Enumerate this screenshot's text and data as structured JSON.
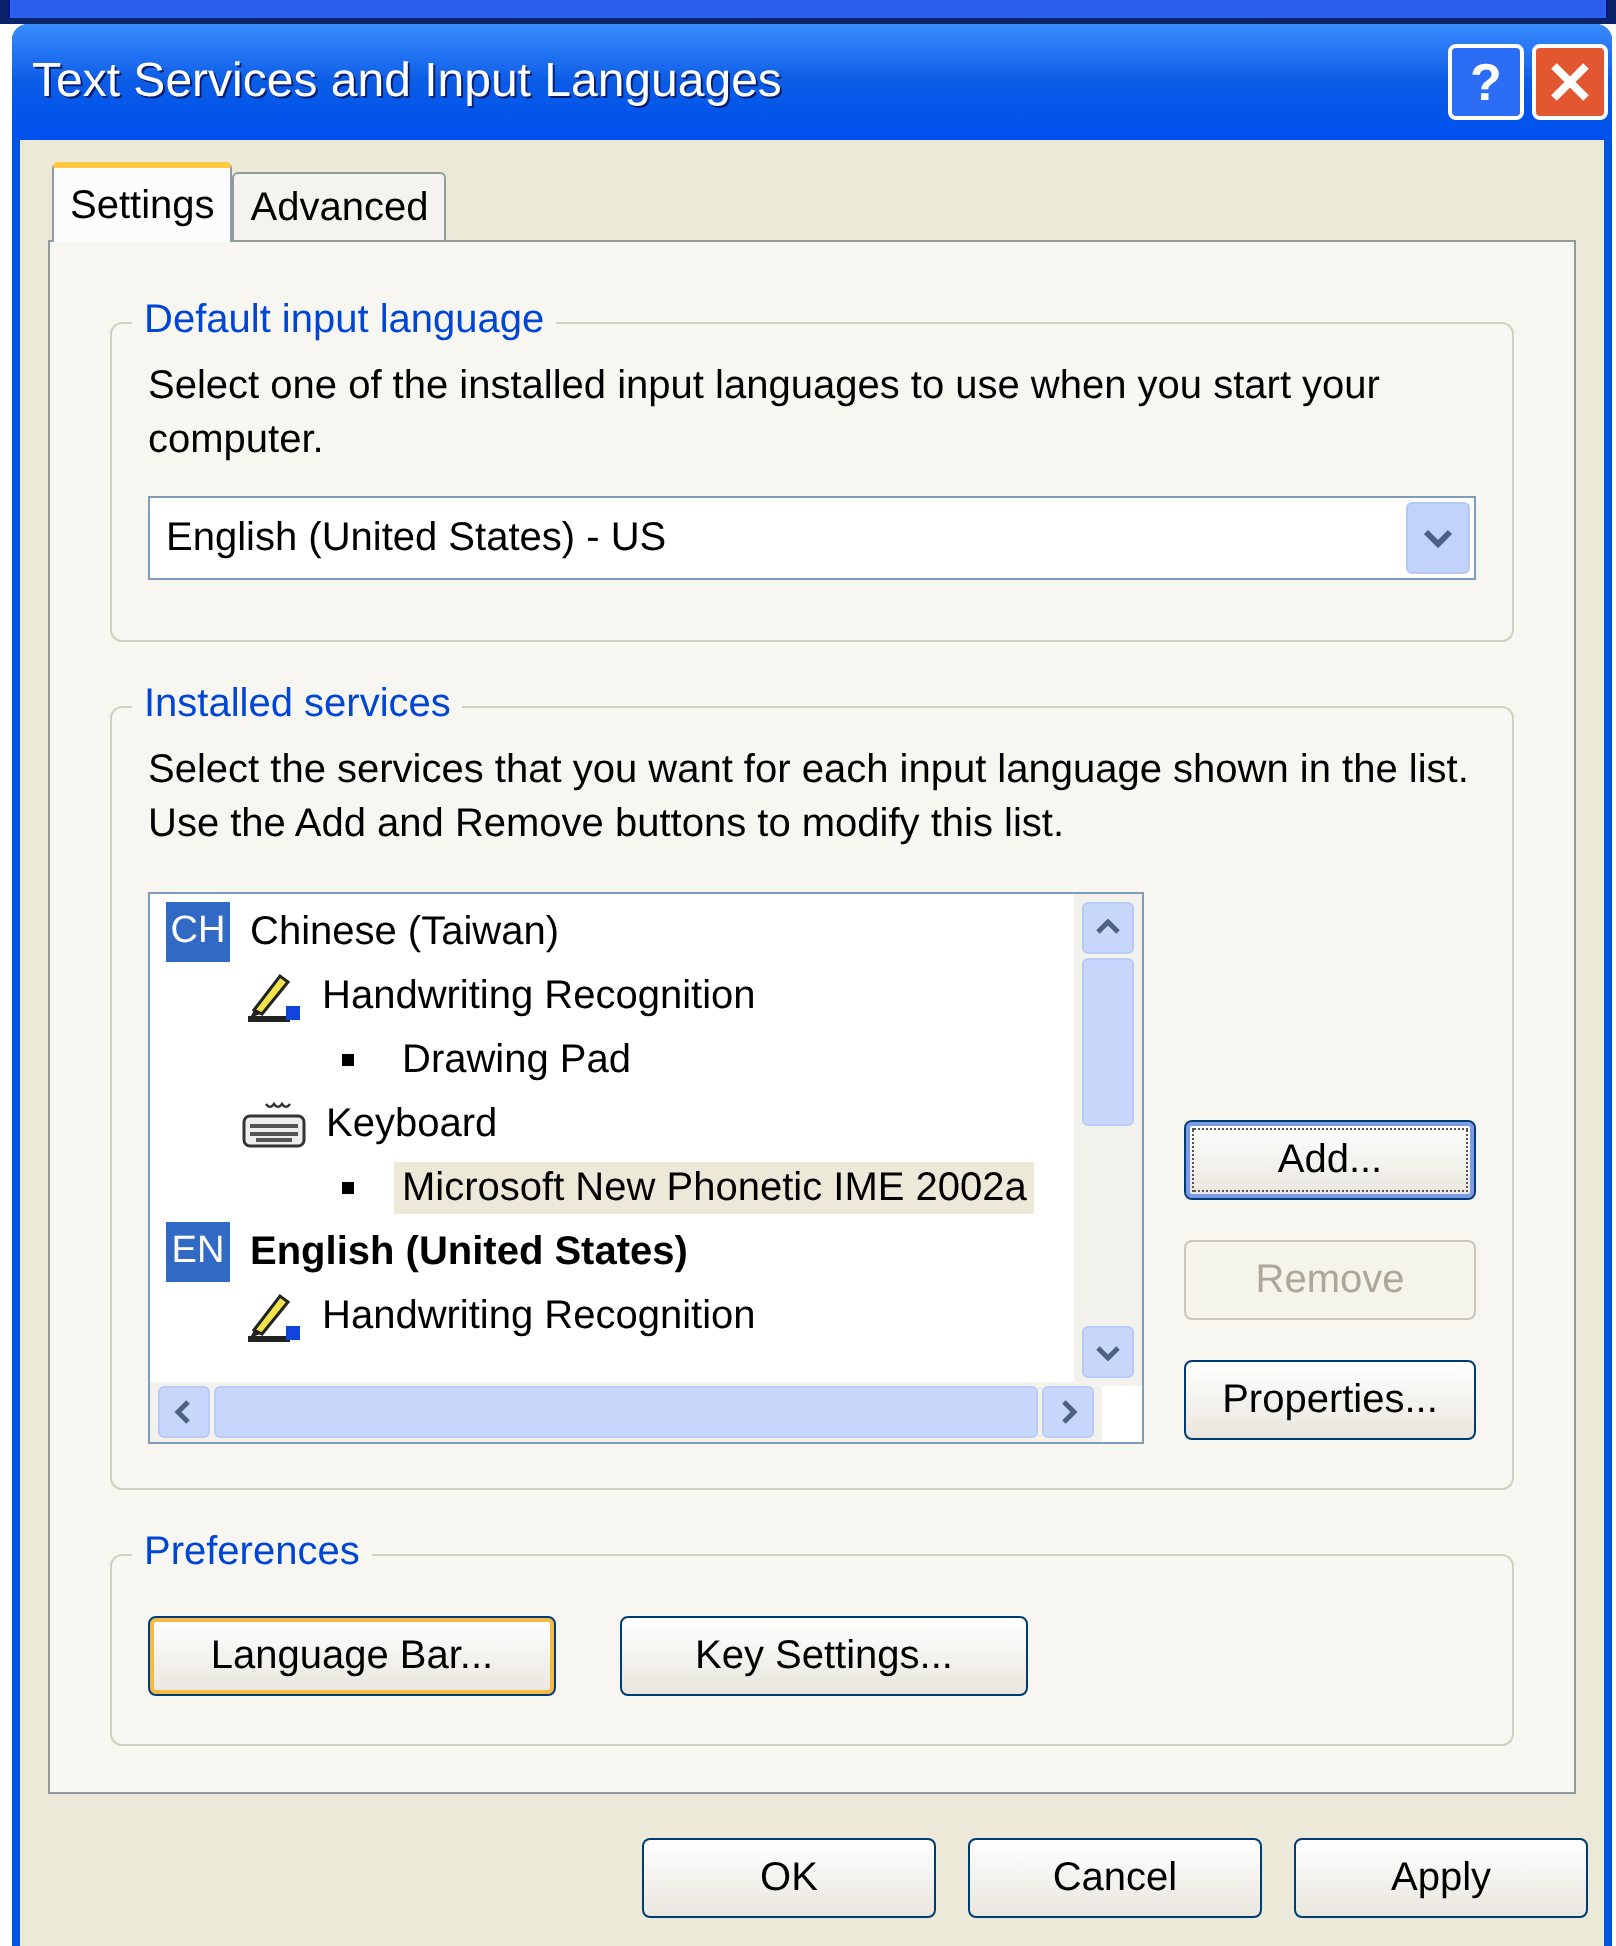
{
  "window": {
    "title": "Text Services and Input Languages",
    "title_buttons": [
      {
        "kind": "help",
        "label": "?"
      },
      {
        "kind": "close"
      }
    ]
  },
  "tabs": [
    {
      "label": "Settings",
      "selected": true
    },
    {
      "label": "Advanced",
      "selected": false
    }
  ],
  "default_input_language": {
    "title": "Default input language",
    "description": "Select one of the installed input languages to use when you start your computer.",
    "value": "English (United States) - US"
  },
  "installed_services": {
    "title": "Installed services",
    "description": "Select the services that you want for each input language shown in the list. Use the Add and Remove buttons to modify this list.",
    "tree": [
      {
        "code": "CH",
        "label": "Chinese (Taiwan)",
        "default": false,
        "children": [
          {
            "kind": "handwriting",
            "label": "Handwriting Recognition",
            "children": [
              {
                "label": "Drawing Pad",
                "selected": false
              }
            ]
          },
          {
            "kind": "keyboard",
            "label": "Keyboard",
            "children": [
              {
                "label": "Microsoft New Phonetic IME 2002a",
                "selected": true
              }
            ]
          }
        ]
      },
      {
        "code": "EN",
        "label": "English (United States)",
        "default": true,
        "children": [
          {
            "kind": "handwriting",
            "label": "Handwriting Recognition"
          }
        ]
      }
    ],
    "buttons": [
      {
        "label": "Add...",
        "focused": true,
        "disabled": false
      },
      {
        "label": "Remove",
        "focused": false,
        "disabled": true
      },
      {
        "label": "Properties...",
        "focused": false,
        "disabled": false
      }
    ]
  },
  "preferences": {
    "title": "Preferences",
    "buttons": [
      {
        "label": "Language Bar...",
        "default": true
      },
      {
        "label": "Key Settings...",
        "default": false
      }
    ]
  },
  "footer_buttons": [
    {
      "label": "OK"
    },
    {
      "label": "Cancel"
    },
    {
      "label": "Apply"
    }
  ]
}
